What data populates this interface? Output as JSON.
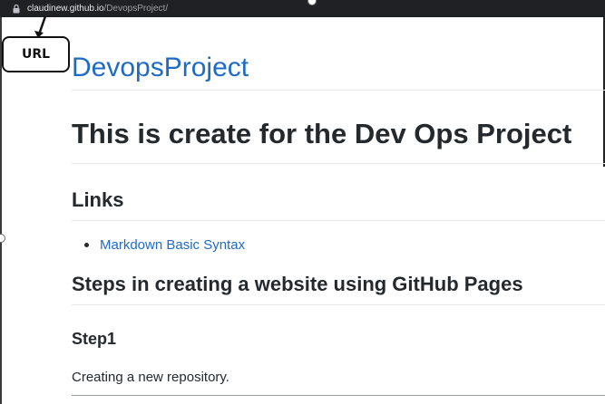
{
  "browser": {
    "url_host": "claudinew.github.io",
    "url_path": "/DevopsProject/",
    "lock_icon": "lock-icon"
  },
  "annotation": {
    "label": "URL"
  },
  "site": {
    "title": "DevopsProject"
  },
  "content": {
    "heading": "This is create for the Dev Ops Project",
    "links_heading": "Links",
    "links": [
      {
        "label": "Markdown Basic Syntax"
      }
    ],
    "steps_heading": "Steps in creating a website using GitHub Pages",
    "step1_heading": "Step1",
    "step1_text": "Creating a new repository."
  },
  "colors": {
    "link": "#1f6bc4",
    "text": "#24292e",
    "address_bar": "#202124"
  }
}
